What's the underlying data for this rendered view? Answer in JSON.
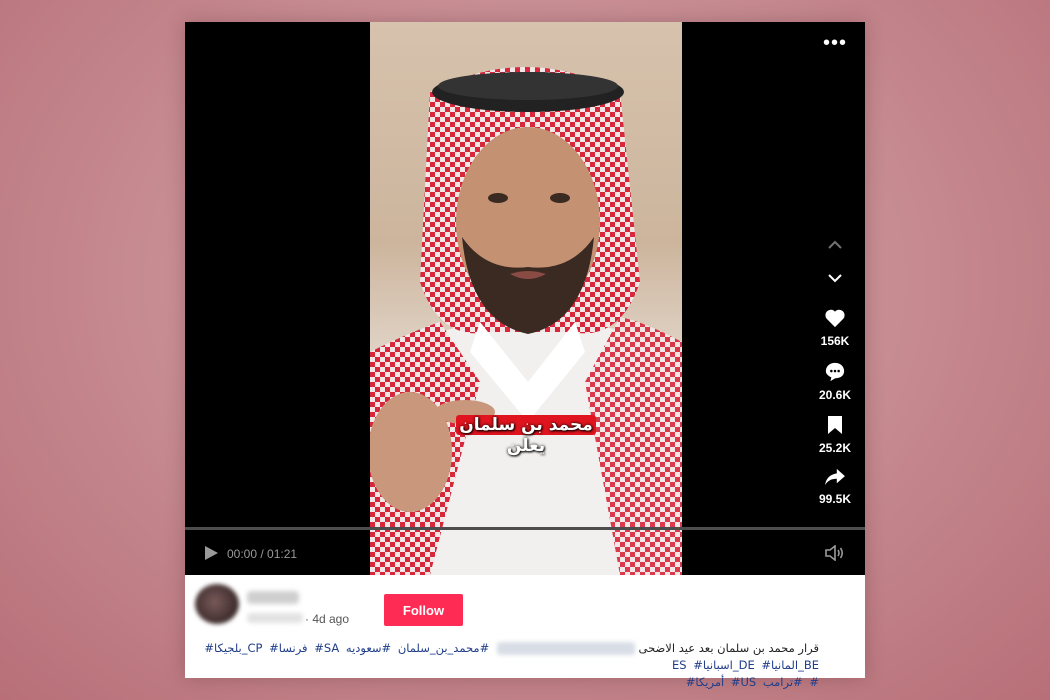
{
  "player": {
    "menu_icon": "more-dots-icon",
    "caption_highlight": "محمد بن سلمان",
    "caption_line2": "يعلن",
    "nav": {
      "up_icon": "chevron-up-icon",
      "down_icon": "chevron-down-icon"
    },
    "actions": [
      {
        "name": "like",
        "icon": "heart-icon",
        "count": "156K"
      },
      {
        "name": "comment",
        "icon": "comment-icon",
        "count": "20.6K"
      },
      {
        "name": "save",
        "icon": "bookmark-icon",
        "count": "25.2K"
      },
      {
        "name": "share",
        "icon": "share-icon",
        "count": "99.5K"
      }
    ],
    "time": "00:00 / 01:21",
    "progress": 0.0
  },
  "post": {
    "age": "· 4d ago",
    "follow_label": "Follow",
    "description": "قرار محمد بن سلمان بعد عيد الاضحى",
    "tags": [
      "#محمد_بن_سلمان",
      "#سعوديه",
      "SA#",
      "فرنسا#",
      "CP_بلجيكا#",
      "BE_المانيا#",
      "DE_اسبانيا#",
      "ES",
      "#ترامب",
      "US#",
      "أمريكا#",
      "#"
    ]
  },
  "colors": {
    "accent": "#fe2c55",
    "caption_highlight": "#e0141e",
    "hashtag": "#1f3d8a"
  }
}
